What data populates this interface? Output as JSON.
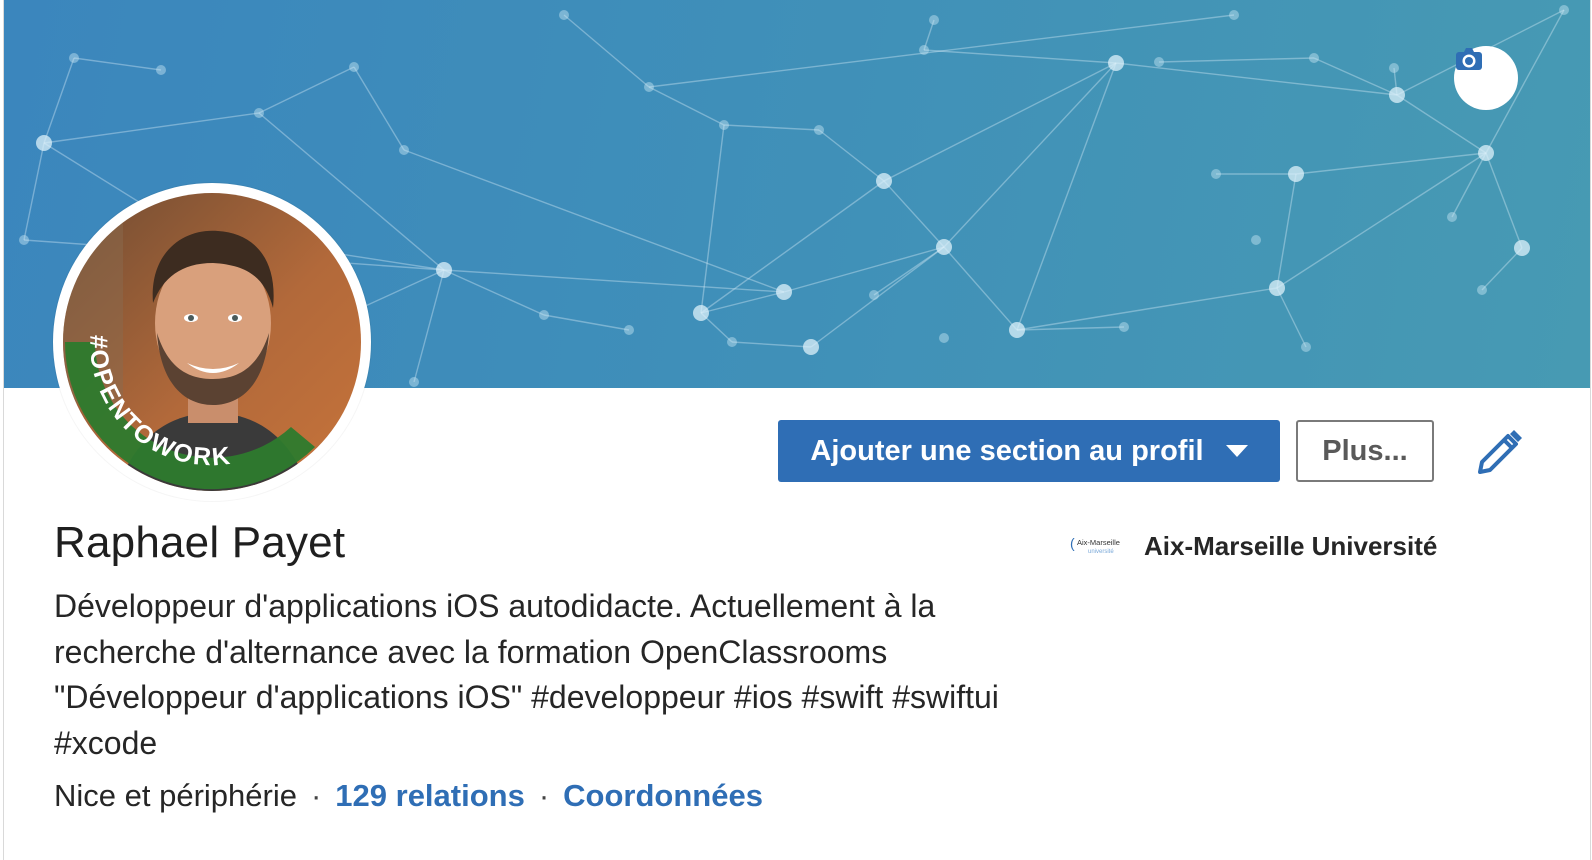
{
  "banner": {
    "camera_icon": "camera-icon",
    "colors": {
      "start": "#3b86bd",
      "end": "#479ab3"
    }
  },
  "avatar": {
    "badge_text": "#OPENTOWORK",
    "badge_color": "#2d7a2d"
  },
  "actions": {
    "primary_label": "Ajouter une section au profil",
    "primary_icon": "caret-down-icon",
    "secondary_label": "Plus...",
    "edit_icon": "pencil-icon"
  },
  "profile": {
    "name": "Raphael Payet",
    "headline": "Développeur d'applications iOS autodidacte. Actuellement à la recherche d'alternance avec la formation OpenClassrooms \"Développeur d'applications iOS\" #developpeur #ios #swift #swiftui #xcode",
    "location": "Nice et périphérie",
    "separator": "·",
    "connections": "129 relations",
    "contact": "Coordonnées"
  },
  "education": {
    "logo_text": "Aix-Marseille université",
    "name": "Aix-Marseille Université"
  },
  "colors": {
    "accent": "#2f6eb5",
    "text": "#262626"
  }
}
